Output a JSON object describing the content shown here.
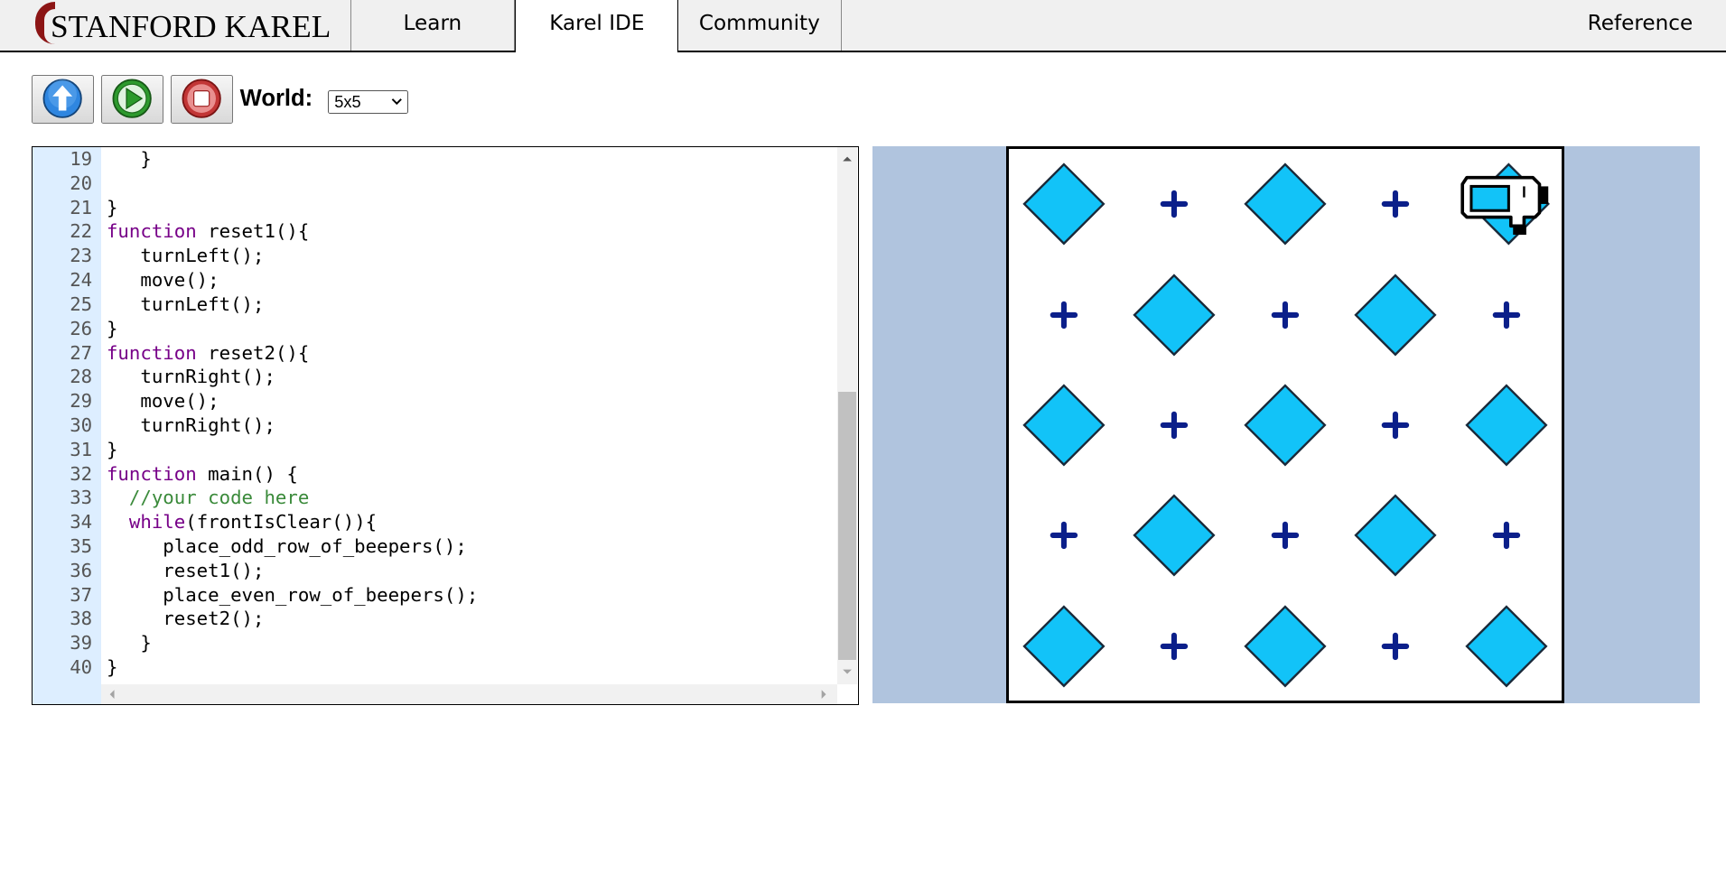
{
  "header": {
    "logo_text": "STANFORD KAREL",
    "tabs": [
      {
        "label": "Learn"
      },
      {
        "label": "Karel IDE",
        "active": true
      },
      {
        "label": "Community"
      }
    ],
    "reference_label": "Reference"
  },
  "toolbar": {
    "buttons": [
      {
        "name": "step",
        "icon": "up-arrow-icon"
      },
      {
        "name": "run",
        "icon": "play-icon"
      },
      {
        "name": "stop",
        "icon": "stop-icon"
      }
    ],
    "world_label": "World:",
    "world_value": "5x5"
  },
  "editor": {
    "lines": [
      {
        "num": "19",
        "text": "   }"
      },
      {
        "num": "20",
        "text": ""
      },
      {
        "num": "21",
        "text": "}"
      },
      {
        "num": "22",
        "text": "function reset1(){"
      },
      {
        "num": "23",
        "text": "   turnLeft();"
      },
      {
        "num": "24",
        "text": "   move();"
      },
      {
        "num": "25",
        "text": "   turnLeft();"
      },
      {
        "num": "26",
        "text": "}"
      },
      {
        "num": "27",
        "text": "function reset2(){"
      },
      {
        "num": "28",
        "text": "   turnRight();"
      },
      {
        "num": "29",
        "text": "   move();"
      },
      {
        "num": "30",
        "text": "   turnRight();"
      },
      {
        "num": "31",
        "text": "}"
      },
      {
        "num": "32",
        "text": "function main() {"
      },
      {
        "num": "33",
        "text": "  //your code here"
      },
      {
        "num": "34",
        "text": "  while(frontIsClear()){"
      },
      {
        "num": "35",
        "text": "     place_odd_row_of_beepers();"
      },
      {
        "num": "36",
        "text": "     reset1();"
      },
      {
        "num": "37",
        "text": "     place_even_row_of_beepers();"
      },
      {
        "num": "38",
        "text": "     reset2();"
      },
      {
        "num": "39",
        "text": "   }"
      },
      {
        "num": "40",
        "text": "}"
      }
    ]
  },
  "world": {
    "rows": 5,
    "cols": 5,
    "cells": [
      [
        "beeper",
        "corner",
        "beeper",
        "corner",
        "karel"
      ],
      [
        "corner",
        "beeper",
        "corner",
        "beeper",
        "corner"
      ],
      [
        "beeper",
        "corner",
        "beeper",
        "corner",
        "beeper"
      ],
      [
        "corner",
        "beeper",
        "corner",
        "beeper",
        "corner"
      ],
      [
        "beeper",
        "corner",
        "beeper",
        "corner",
        "beeper"
      ]
    ],
    "karel_facing": "east",
    "colors": {
      "beeper": "#12c3f8",
      "corner": "#0b1f8a",
      "wall": "#000000",
      "background": "#b0c4de"
    }
  }
}
